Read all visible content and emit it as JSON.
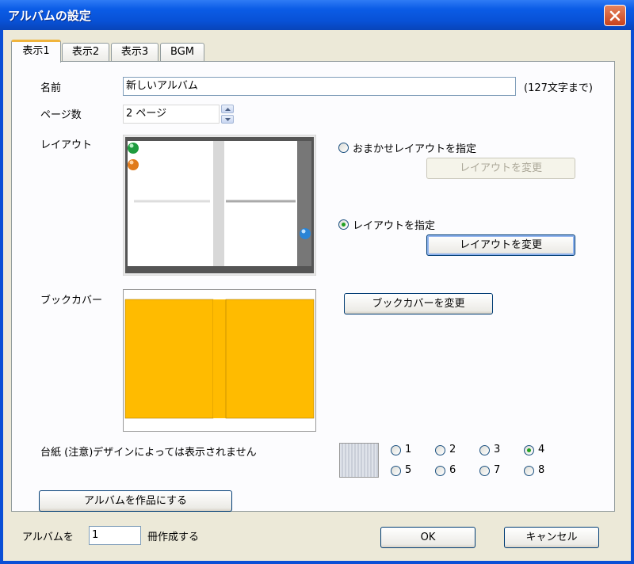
{
  "window": {
    "title": "アルバムの設定"
  },
  "tabs": [
    "表示1",
    "表示2",
    "表示3",
    "BGM"
  ],
  "name": {
    "label": "名前",
    "value": "新しいアルバム",
    "hint": "(127文字まで)"
  },
  "pages": {
    "label": "ページ数",
    "value": "2 ページ"
  },
  "layout": {
    "label": "レイアウト",
    "auto_option": "おまかせレイアウトを指定",
    "auto_button": "レイアウトを変更",
    "manual_option": "レイアウトを指定",
    "manual_button": "レイアウトを変更",
    "selected": "manual"
  },
  "cover": {
    "label": "ブックカバー",
    "button": "ブックカバーを変更",
    "color": "#ffbb00"
  },
  "mount": {
    "label": "台紙 (注意)デザインによっては表示されません",
    "options": [
      "1",
      "2",
      "3",
      "4",
      "5",
      "6",
      "7",
      "8"
    ],
    "selected": "4"
  },
  "make_button": "アルバムを作品にする",
  "footer": {
    "prefix": "アルバムを",
    "count": "1",
    "suffix": "冊作成する",
    "ok": "OK",
    "cancel": "キャンセル"
  }
}
